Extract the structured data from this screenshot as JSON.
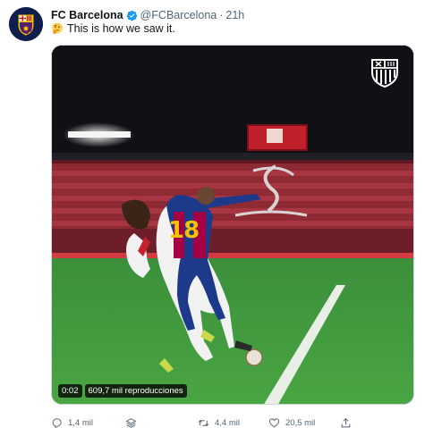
{
  "account": {
    "name": "FC Barcelona",
    "handle": "@FCBarcelona",
    "separator": "·",
    "time": "21h"
  },
  "icons": {
    "avatar": "fc-barcelona-crest-icon",
    "verified": "verified-badge-icon",
    "emoji": "thinking-face-emoji",
    "watermark": "fc-barcelona-crest-icon",
    "reply": "reply-icon",
    "stack": "stack-icon",
    "retweet": "retweet-icon",
    "like": "heart-icon",
    "share": "share-icon"
  },
  "tweet": {
    "text": "This is how we saw it."
  },
  "video": {
    "duration": "0:02",
    "views": "609,7 mil reproducciones",
    "player_number": "18"
  },
  "actions": {
    "replies": "1,4 mil",
    "retweets": "4,4 mil",
    "likes": "20,5 mil"
  },
  "colors": {
    "verified": "#1d9bf0",
    "secondary_text": "#536471",
    "pitch": "#3f9a3a",
    "stands": "#b0323c"
  }
}
